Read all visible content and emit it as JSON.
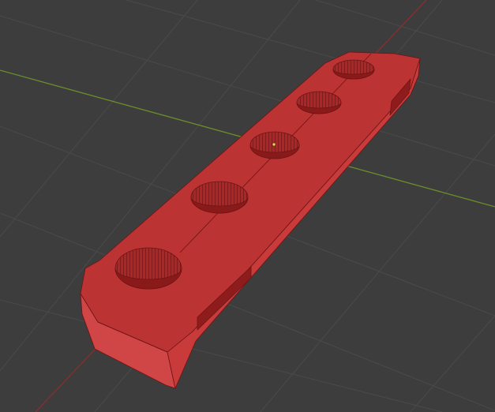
{
  "viewport": {
    "background": "#3d3d3d",
    "grid_color": "#4a4a4a",
    "x_axis_color": "#8a2e2e",
    "y_axis_color": "#6a8f2a"
  },
  "object": {
    "name": "",
    "hole_count": 5,
    "slot_count": 2,
    "colors": {
      "top": "#bc3333",
      "side_front": "#c93b3b",
      "side_left": "#d04545",
      "edge": "#6e1414",
      "hole_inner": "#9a1f1f",
      "hole_hatch": "#5a0c0c"
    }
  },
  "origin_marker": {
    "color": "#ffd84a"
  }
}
